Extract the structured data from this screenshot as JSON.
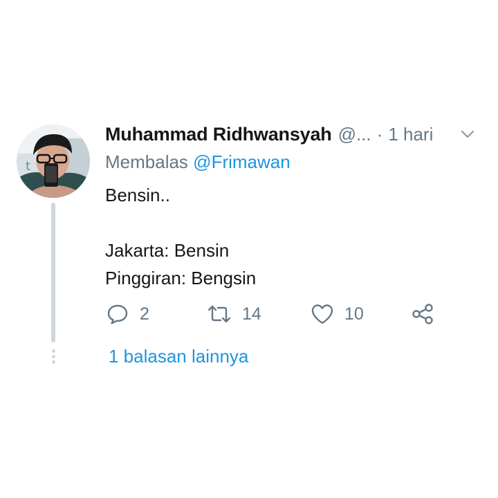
{
  "tweet": {
    "author_name": "Muhammad Ridhwansyah",
    "handle": "@...",
    "separator": "·",
    "time": "1 hari",
    "caret_icon": "chevron-down-icon",
    "reply_to_prefix": "Membalas",
    "reply_to_mention": "@Frimawan",
    "text_lines": [
      "Bensin..",
      "",
      "Jakarta: Bensin",
      "Pinggiran: Bengsin"
    ],
    "avatar_icon": "avatar"
  },
  "actions": {
    "reply": {
      "icon": "reply-icon",
      "count": "2"
    },
    "retweet": {
      "icon": "retweet-icon",
      "count": "14"
    },
    "like": {
      "icon": "heart-icon",
      "count": "10"
    },
    "share": {
      "icon": "share-icon"
    }
  },
  "thread": {
    "more_replies_label": "1 balasan lainnya"
  },
  "colors": {
    "name": "#14171a",
    "secondary": "#657786",
    "link": "#1b95e0",
    "thread_line": "#cfd7de",
    "background": "#ffffff"
  }
}
